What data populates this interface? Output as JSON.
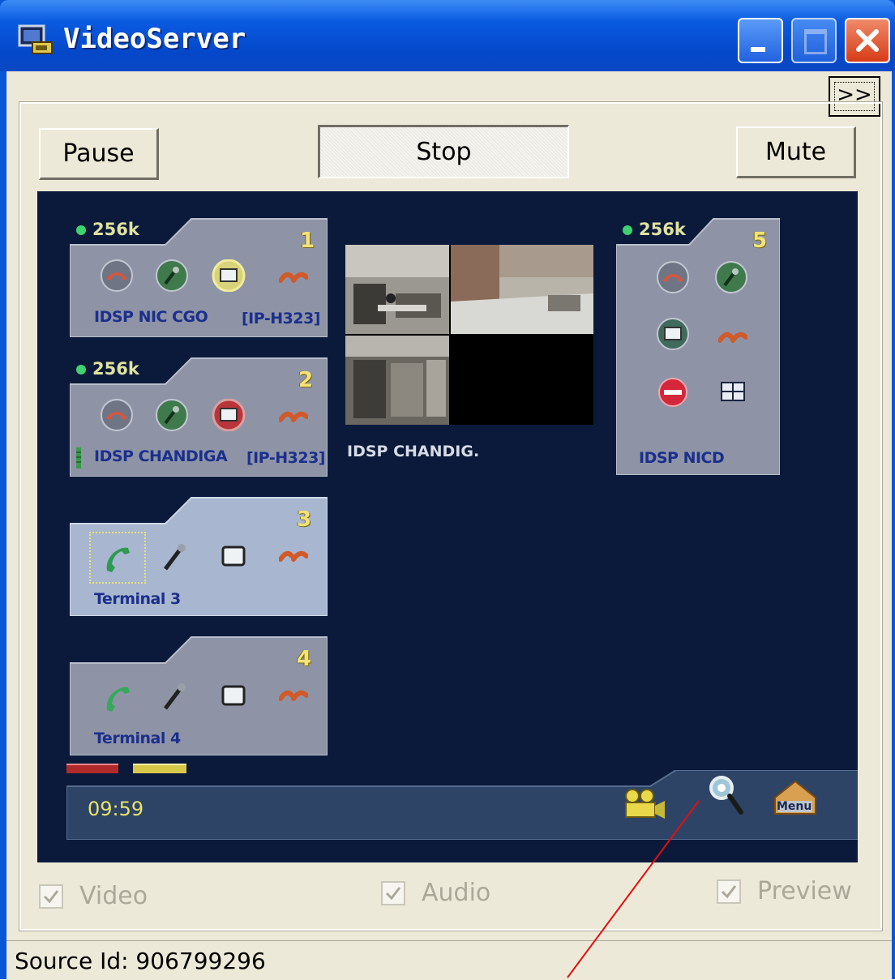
{
  "window": {
    "title": "VideoServer"
  },
  "toolbar": {
    "expand_label": ">>",
    "pause_label": "Pause",
    "stop_label": "Stop",
    "mute_label": "Mute"
  },
  "terminals": [
    {
      "number": "1",
      "rate": "256k",
      "name": "IDSP NIC CGO",
      "protocol": "[IP-H323]"
    },
    {
      "number": "2",
      "rate": "256k",
      "name": "IDSP CHANDIGA",
      "protocol": "[IP-H323]"
    },
    {
      "number": "3",
      "name": "Terminal 3"
    },
    {
      "number": "4",
      "name": "Terminal 4"
    },
    {
      "number": "5",
      "rate": "256k",
      "name": "IDSP NICD"
    }
  ],
  "video": {
    "caption": "IDSP CHANDIG."
  },
  "status_panel": {
    "timer": "09:59",
    "menu_label": "Menu"
  },
  "options": {
    "video_label": "Video",
    "audio_label": "Audio",
    "preview_label": "Preview",
    "video_checked": true,
    "audio_checked": true,
    "preview_checked": true
  },
  "statusbar": {
    "text": "Source Id: 906799296"
  },
  "colors": {
    "panel_bg": "#0b1a3a",
    "card_bg": "#8e94a6",
    "active_card_bg": "#a8b6cf",
    "titlebar": "#0a5be0"
  }
}
